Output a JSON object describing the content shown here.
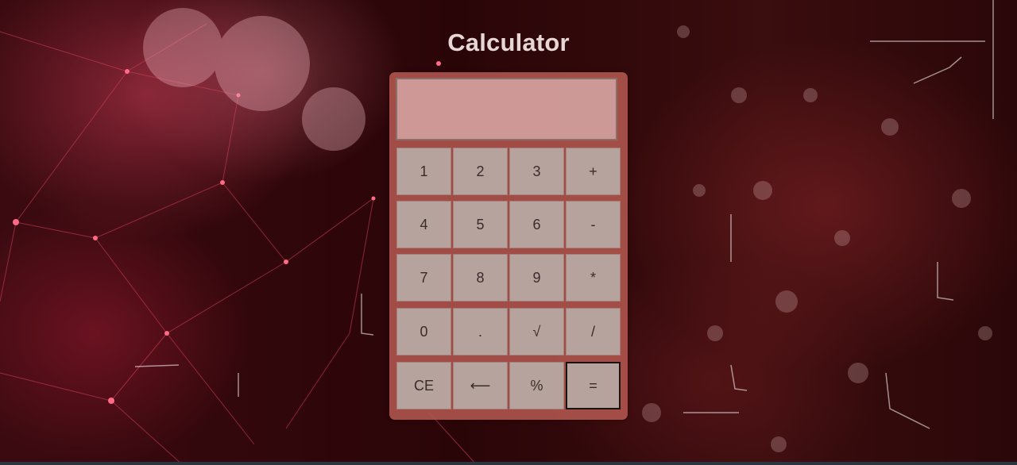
{
  "page": {
    "title": "Calculator"
  },
  "display": {
    "value": ""
  },
  "keys": {
    "k1": "1",
    "k2": "2",
    "k3": "3",
    "plus": "+",
    "k4": "4",
    "k5": "5",
    "k6": "6",
    "minus": "-",
    "k7": "7",
    "k8": "8",
    "k9": "9",
    "multiply": "*",
    "k0": "0",
    "dot": ".",
    "sqrt": "√",
    "divide": "/",
    "ce": "CE",
    "backspace": "⟵",
    "percent": "%",
    "equals": "="
  },
  "colors": {
    "background": "#2a0508",
    "panel": "#b2564e",
    "key": "#b7a39d",
    "title": "#e6d6d4"
  }
}
